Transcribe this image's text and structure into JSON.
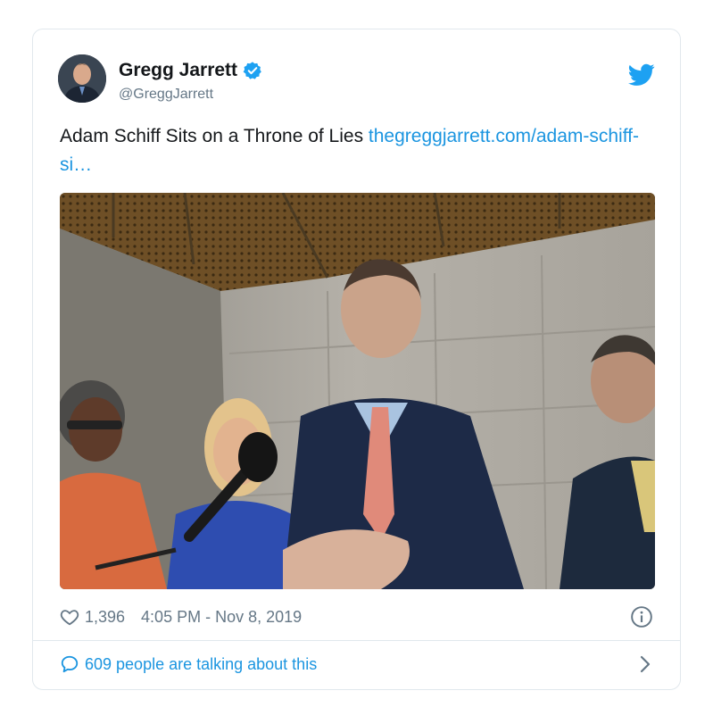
{
  "tweet": {
    "author_name": "Gregg Jarrett",
    "author_handle": "@GreggJarrett",
    "text": "Adam Schiff Sits on a Throne of Lies ",
    "link_text": "thegreggjarrett.com/adam-schiff-si…",
    "verified": true,
    "likes": "1,396",
    "timestamp": "4:05 PM - Nov 8, 2019",
    "conversation": "609 people are talking about this"
  },
  "icons": {
    "verified": "verified-badge-icon",
    "twitter": "twitter-bird-icon",
    "like": "heart-icon",
    "info": "info-icon",
    "reply": "speech-bubble-icon",
    "chevron": "chevron-right-icon"
  },
  "colors": {
    "link": "#1b95e0",
    "meta": "#657786",
    "verified": "#1da1f2",
    "border": "#e1e8ed"
  }
}
